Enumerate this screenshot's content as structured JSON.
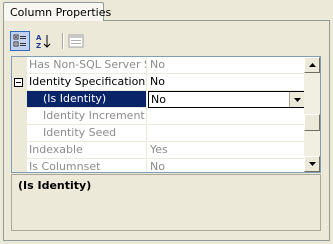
{
  "tab": {
    "label": "Column Properties"
  },
  "toolbar": {
    "buttons": [
      {
        "name": "categorized",
        "icon": "categorized-icon",
        "active": true
      },
      {
        "name": "alphabetical",
        "icon": "sort-az-icon",
        "active": false
      },
      {
        "name": "property-pages",
        "icon": "property-pages-icon",
        "active": false
      }
    ]
  },
  "grid": {
    "rows": [
      {
        "name": "Has Non-SQL Server Subscriber",
        "value": "No",
        "disabled": true
      },
      {
        "name": "Identity Specification",
        "value": "No",
        "disabled": false,
        "expanded": true
      },
      {
        "name": "(Is Identity)",
        "value": "No",
        "selected": true
      },
      {
        "name": "Identity Increment",
        "value": "",
        "disabled": true
      },
      {
        "name": "Identity Seed",
        "value": "",
        "disabled": true
      },
      {
        "name": "Indexable",
        "value": "Yes",
        "disabled": true
      },
      {
        "name": "Is Columnset",
        "value": "No",
        "disabled": true
      }
    ]
  },
  "help": {
    "title": "(Is Identity)",
    "description": ""
  },
  "colors": {
    "selection": "#0a246a",
    "disabled_text": "#8c8c8c",
    "panel": "#ece9d8"
  }
}
